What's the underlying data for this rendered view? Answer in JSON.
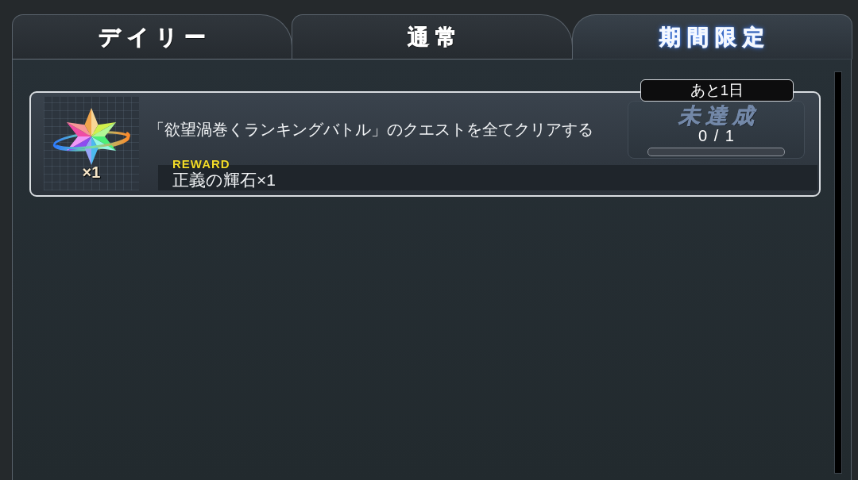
{
  "tabs": [
    {
      "label": "デイリー",
      "selected": false
    },
    {
      "label": "通常",
      "selected": false
    },
    {
      "label": "期間限定",
      "selected": true
    }
  ],
  "quests": [
    {
      "item_count": "×1",
      "description": "「欲望渦巻くランキングバトル」のクエストを全てクリアする",
      "reward_label": "REWARD",
      "reward": "正義の輝石×1",
      "time_left": "あと1日",
      "status": "未達成",
      "completed": false,
      "progress": "0 / 1",
      "level": 0
    }
  ]
}
